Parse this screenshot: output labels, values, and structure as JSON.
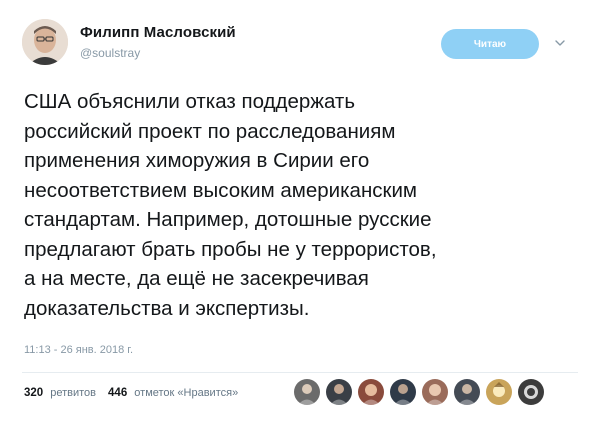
{
  "author": {
    "name": "Филипп Масловский",
    "handle": "@soulstray",
    "avatar_icon": "profile-photo"
  },
  "follow_button": {
    "label": "Читаю",
    "color": "#8fd0f5"
  },
  "menu_icon": "chevron-down-icon",
  "tweet": {
    "lines": [
      "США объяснили отказ поддержать",
      "российский проект по расследованиям",
      "применения химоружия в Сирии его",
      "несоответствием высоким американским",
      "стандартам. Например, дотошные русские",
      "предлагают брать пробы не у террористов,",
      "а на месте, да ещё не засекречивая",
      "доказательства и экспертизы."
    ],
    "timestamp": "11:13 - 26 янв. 2018 г."
  },
  "stats": {
    "retweets_count": "320",
    "retweets_label": "ретвитов",
    "likes_count": "446",
    "likes_label": "отметок «Нравится»"
  },
  "likers": [
    {
      "icon": "liker-avatar-1",
      "color": "#6b6b6b"
    },
    {
      "icon": "liker-avatar-2",
      "color": "#3a3f46"
    },
    {
      "icon": "liker-avatar-3",
      "color": "#8a4b3c"
    },
    {
      "icon": "liker-avatar-4",
      "color": "#2f3a48"
    },
    {
      "icon": "liker-avatar-5",
      "color": "#9a6b5a"
    },
    {
      "icon": "liker-avatar-6",
      "color": "#444b55"
    },
    {
      "icon": "liker-avatar-7",
      "color": "#c9a45a"
    },
    {
      "icon": "liker-avatar-8",
      "color": "#3c3c3c"
    }
  ]
}
